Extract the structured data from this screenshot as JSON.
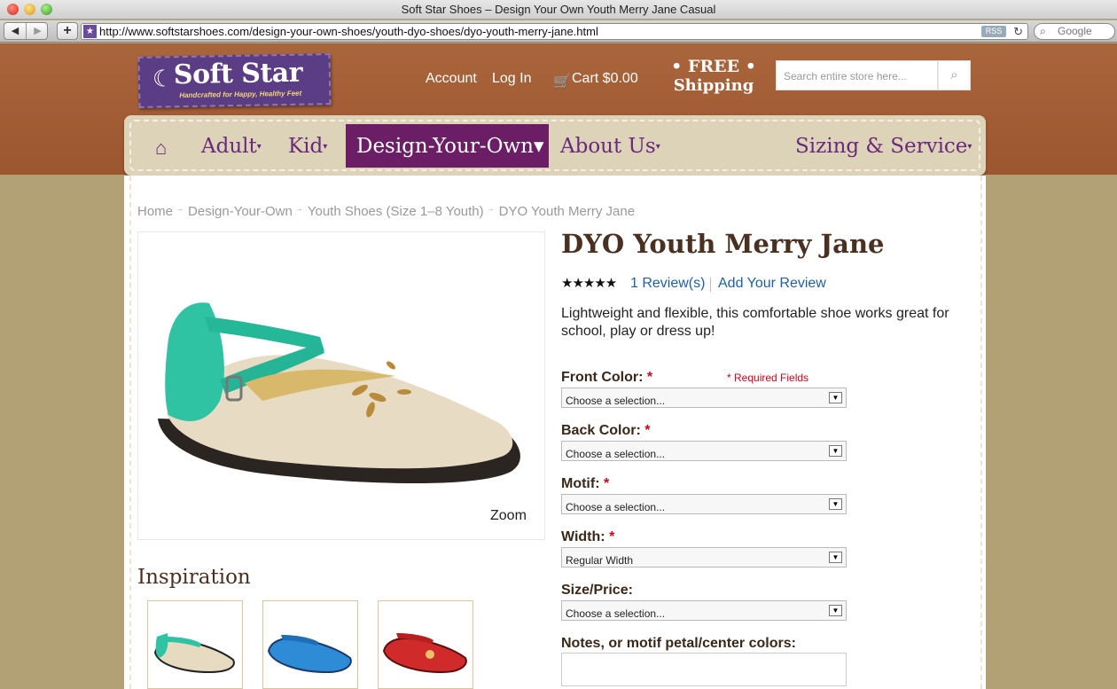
{
  "browser": {
    "window_title": "Soft Star Shoes – Design Your Own Youth Merry Jane Casual",
    "url": "http://www.softstarshoes.com/design-your-own-shoes/youth-dyo-shoes/dyo-youth-merry-jane.html",
    "rss_label": "RSS",
    "search_placeholder": "Google"
  },
  "header": {
    "logo_name": "Soft Star",
    "logo_tagline": "Handcrafted for Happy, Healthy Feet",
    "account": "Account",
    "login": "Log In",
    "cart": "Cart $0.00",
    "free_line1": "• FREE •",
    "free_line2": "Shipping",
    "search_placeholder": "Search entire store here..."
  },
  "nav": {
    "adult": "Adult",
    "kid": "Kid",
    "dyo": "Design-Your-Own",
    "about": "About Us",
    "sizing": "Sizing & Service"
  },
  "breadcrumb": [
    "Home",
    "Design-Your-Own",
    "Youth Shoes (Size 1–8 Youth)",
    "DYO Youth Merry Jane"
  ],
  "product": {
    "title": "DYO Youth Merry Jane",
    "stars": "★★★★★",
    "reviews": "1 Review(s)",
    "add_review": "Add Your Review",
    "description": "Lightweight and flexible, this comfortable shoe works great for school, play or dress up!",
    "zoom": "Zoom",
    "required_note": "* Required Fields"
  },
  "form": {
    "front_color": {
      "label": "Front Color:",
      "value": "Choose a selection..."
    },
    "back_color": {
      "label": "Back Color:",
      "value": "Choose a selection..."
    },
    "motif": {
      "label": "Motif:",
      "value": "Choose a selection..."
    },
    "width": {
      "label": "Width:",
      "value": "Regular Width"
    },
    "size_price": {
      "label": "Size/Price:",
      "value": "Choose a selection..."
    },
    "notes_label": "Notes, or motif petal/center colors:"
  },
  "inspiration": {
    "heading": "Inspiration"
  },
  "colors": {
    "brand_purple": "#6b1d66",
    "header_brown": "#a9653b",
    "link_blue": "#1f5fa6",
    "required_red": "#d0021b"
  }
}
